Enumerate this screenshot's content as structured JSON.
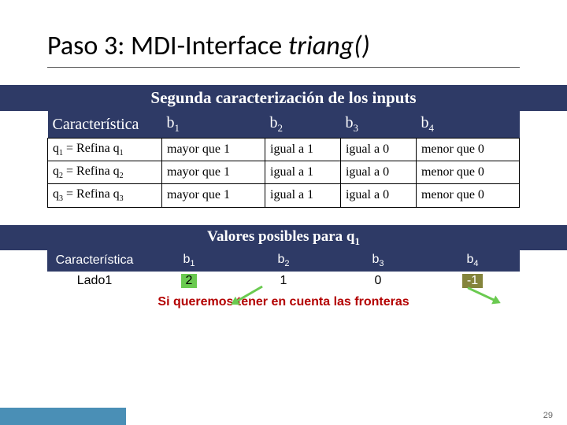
{
  "title_plain": "Paso 3: MDI-Interface ",
  "title_italic": "triang()",
  "banner1": "Segunda caracterización de los inputs",
  "table1": {
    "head": {
      "c0": "Característica",
      "c1": "b",
      "c1s": "1",
      "c2": "b",
      "c2s": "2",
      "c3": "b",
      "c3s": "3",
      "c4": "b",
      "c4s": "4"
    },
    "rows": [
      {
        "a_pre": "q",
        "a_s1": "1",
        "a_mid": " = Refina q",
        "a_s2": "1",
        "b1": "mayor que 1",
        "b2": "igual a 1",
        "b3": "igual a 0",
        "b4": "menor que 0"
      },
      {
        "a_pre": "q",
        "a_s1": "2",
        "a_mid": " = Refina q",
        "a_s2": "2",
        "b1": "mayor que 1",
        "b2": "igual a 1",
        "b3": "igual a 0",
        "b4": "menor que 0"
      },
      {
        "a_pre": "q",
        "a_s1": "3",
        "a_mid": " = Refina q",
        "a_s2": "3",
        "b1": "mayor que 1",
        "b2": "igual a 1",
        "b3": "igual a 0",
        "b4": "menor que 0"
      }
    ]
  },
  "banner2_pre": "Valores posibles para q",
  "banner2_sub": "1",
  "table2": {
    "head": {
      "c0": "Característica",
      "c1": "b",
      "c1s": "1",
      "c2": "b",
      "c2s": "2",
      "c3": "b",
      "c3s": "3",
      "c4": "b",
      "c4s": "4"
    },
    "row": {
      "label": "Lado1",
      "v1": "2",
      "v2": "1",
      "v3": "0",
      "v4": "-1"
    }
  },
  "note": "Si queremos tener en cuenta las fronteras",
  "page": "29",
  "colors": {
    "navy": "#2e3a66",
    "green": "#6aca50",
    "olive": "#84843c",
    "red": "#b30000",
    "footer": "#4a8fb6"
  }
}
